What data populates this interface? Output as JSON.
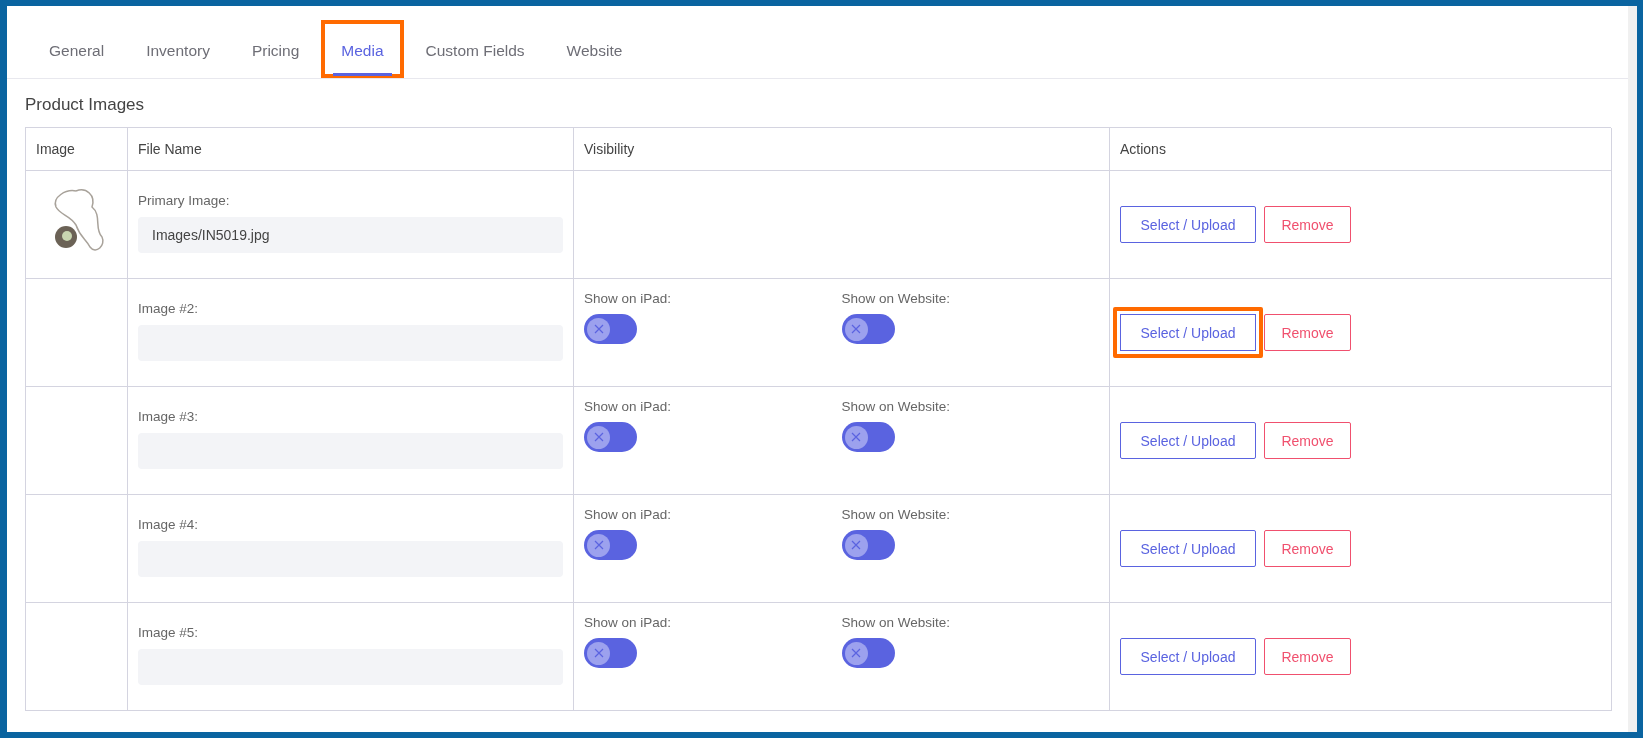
{
  "tabs": [
    {
      "label": "General",
      "selected": false,
      "highlighted": false
    },
    {
      "label": "Inventory",
      "selected": false,
      "highlighted": false
    },
    {
      "label": "Pricing",
      "selected": false,
      "highlighted": false
    },
    {
      "label": "Media",
      "selected": true,
      "highlighted": true
    },
    {
      "label": "Custom Fields",
      "selected": false,
      "highlighted": false
    },
    {
      "label": "Website",
      "selected": false,
      "highlighted": false
    }
  ],
  "section_title": "Product Images",
  "table": {
    "columns": [
      "Image",
      "File Name",
      "Visibility",
      "Actions"
    ],
    "rows": [
      {
        "has_image": true,
        "label": "Primary Image:",
        "value": "Images/IN5019.jpg",
        "toggles": [],
        "select_button": {
          "label": "Select / Upload",
          "highlighted": false
        },
        "remove_button": "Remove"
      },
      {
        "has_image": false,
        "label": "Image #2:",
        "value": "",
        "toggles": [
          {
            "label": "Show on iPad:",
            "on": false
          },
          {
            "label": "Show on Website:",
            "on": false
          }
        ],
        "select_button": {
          "label": "Select / Upload",
          "highlighted": true
        },
        "remove_button": "Remove"
      },
      {
        "has_image": false,
        "label": "Image #3:",
        "value": "",
        "toggles": [
          {
            "label": "Show on iPad:",
            "on": false
          },
          {
            "label": "Show on Website:",
            "on": false
          }
        ],
        "select_button": {
          "label": "Select / Upload",
          "highlighted": false
        },
        "remove_button": "Remove"
      },
      {
        "has_image": false,
        "label": "Image #4:",
        "value": "",
        "toggles": [
          {
            "label": "Show on iPad:",
            "on": false
          },
          {
            "label": "Show on Website:",
            "on": false
          }
        ],
        "select_button": {
          "label": "Select / Upload",
          "highlighted": false
        },
        "remove_button": "Remove"
      },
      {
        "has_image": false,
        "label": "Image #5:",
        "value": "",
        "toggles": [
          {
            "label": "Show on iPad:",
            "on": false
          },
          {
            "label": "Show on Website:",
            "on": false
          }
        ],
        "select_button": {
          "label": "Select / Upload",
          "highlighted": false
        },
        "remove_button": "Remove"
      }
    ]
  }
}
